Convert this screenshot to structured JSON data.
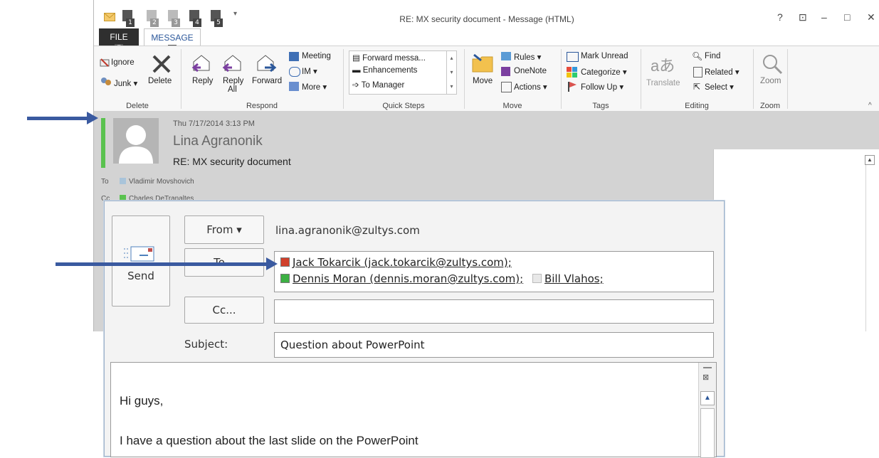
{
  "window": {
    "title": "RE: MX security document - Message (HTML)",
    "qat_numbers": [
      "1",
      "2",
      "3",
      "4",
      "5"
    ],
    "controls": [
      "?",
      "⊡",
      "–",
      "□",
      "✕"
    ]
  },
  "tabs": {
    "file": {
      "label": "FILE",
      "keytip": "F"
    },
    "message": {
      "label": "MESSAGE",
      "keytip": "H"
    }
  },
  "ribbon": {
    "delete_group": {
      "label": "Delete",
      "ignore": "Ignore",
      "junk": "Junk",
      "delete": "Delete"
    },
    "respond_group": {
      "label": "Respond",
      "reply": "Reply",
      "reply_all_1": "Reply",
      "reply_all_2": "All",
      "forward": "Forward",
      "meeting": "Meeting",
      "im": "IM",
      "more": "More"
    },
    "quicksteps_group": {
      "label": "Quick Steps",
      "items": [
        "Forward messa...",
        "Enhancements",
        "To Manager"
      ]
    },
    "move_group": {
      "label": "Move",
      "move": "Move",
      "rules": "Rules",
      "onenote": "OneNote",
      "actions": "Actions"
    },
    "tags_group": {
      "label": "Tags",
      "mark_unread": "Mark Unread",
      "categorize": "Categorize",
      "follow_up": "Follow Up"
    },
    "editing_group": {
      "label": "Editing",
      "translate": "Translate",
      "find": "Find",
      "related": "Related",
      "select": "Select"
    },
    "zoom_group": {
      "label": "Zoom",
      "zoom": "Zoom"
    }
  },
  "message_header": {
    "date": "Thu 7/17/2014 3:13 PM",
    "sender": "Lina Agranonik",
    "subject": "RE: MX security document",
    "to_label": "To",
    "to_name": "Vladimir Movshovich",
    "cc_label": "Cc",
    "cc_name": "Charles DeTranaltes"
  },
  "compose": {
    "send_label": "Send",
    "from_label": "From ▾",
    "from_value": "lina.agranonik@zultys.com",
    "to_label": "To...",
    "recipients": [
      {
        "text": "Jack Tokarcik (jack.tokarcik@zultys.com);",
        "color": "#d0402c"
      },
      {
        "text": "Dennis Moran (dennis.moran@zultys.com);",
        "color": "#3cb043"
      },
      {
        "text": "Bill Vlahos;",
        "color": "#e8e8e8"
      }
    ],
    "cc_label": "Cc...",
    "cc_value": "",
    "subject_label": "Subject:",
    "subject_value": "Question about PowerPoint",
    "body_lines": [
      "Hi guys,",
      "I have a question about the last slide on the PowerPoint"
    ]
  },
  "colors": {
    "accent": "#2b579a",
    "arrow": "#3a5aa0",
    "presence_available": "#5ac24f"
  }
}
